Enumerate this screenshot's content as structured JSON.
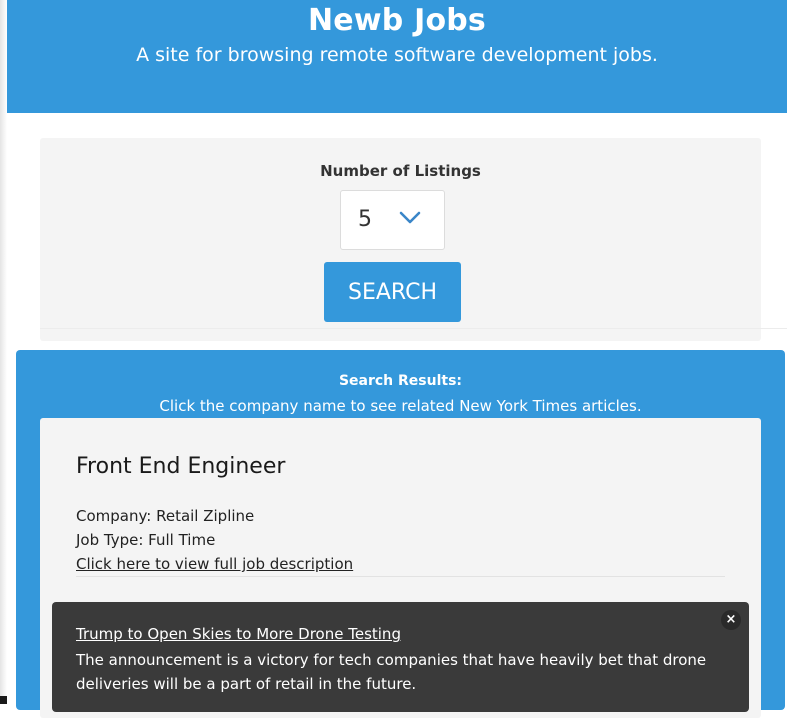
{
  "header": {
    "title": "Newb Jobs",
    "tagline": "A site for browsing remote software development jobs."
  },
  "search": {
    "label": "Number of Listings",
    "selected_value": "5",
    "button_label": "SEARCH"
  },
  "results": {
    "title": "Search Results:",
    "subtitle": "Click the company name to see related New York Times articles.",
    "jobs": [
      {
        "title": "Front End Engineer",
        "company": "Company: Retail Zipline",
        "job_type": "Job Type: Full Time",
        "link_text": "Click here to view full job description"
      }
    ]
  },
  "article_popup": {
    "title": "Trump to Open Skies to More Drone Testing",
    "description": "The announcement is a victory for tech companies that have heavily bet that drone deliveries will be a part of retail in the future.",
    "close_label": "×"
  },
  "colors": {
    "primary": "#3498db",
    "panel": "#f4f4f4",
    "popup": "#3a3a3a"
  },
  "icons": {
    "select_chevron": "chevron-down-icon",
    "popup_close": "close-icon"
  }
}
